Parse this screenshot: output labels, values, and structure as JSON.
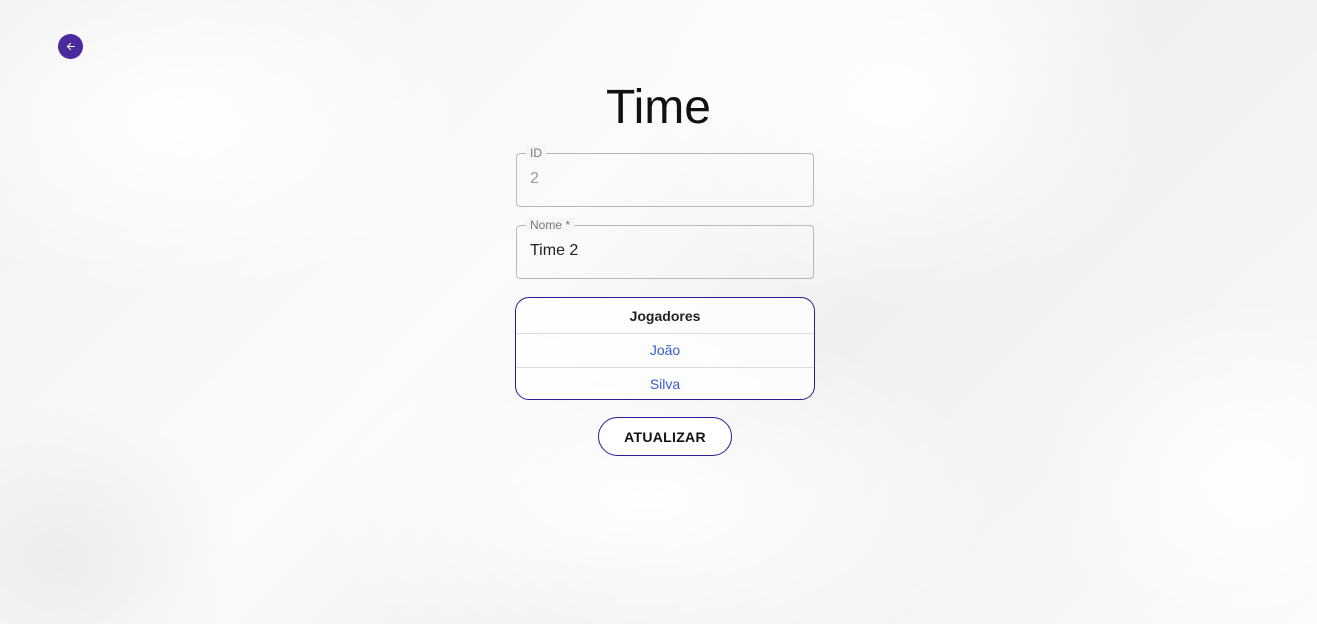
{
  "page": {
    "title": "Time"
  },
  "back_button": {
    "icon": "arrow-left-icon",
    "color": "#4a2a9c"
  },
  "form": {
    "id_field": {
      "label": "ID",
      "value": "2"
    },
    "name_field": {
      "label": "Nome *",
      "value": "Time 2"
    }
  },
  "players": {
    "header": "Jogadores",
    "items": [
      {
        "name": "João"
      },
      {
        "name": "Silva"
      }
    ],
    "link_color": "#3b5bd0",
    "border_color": "#2b1d8f"
  },
  "actions": {
    "update_label": "ATUALIZAR"
  }
}
